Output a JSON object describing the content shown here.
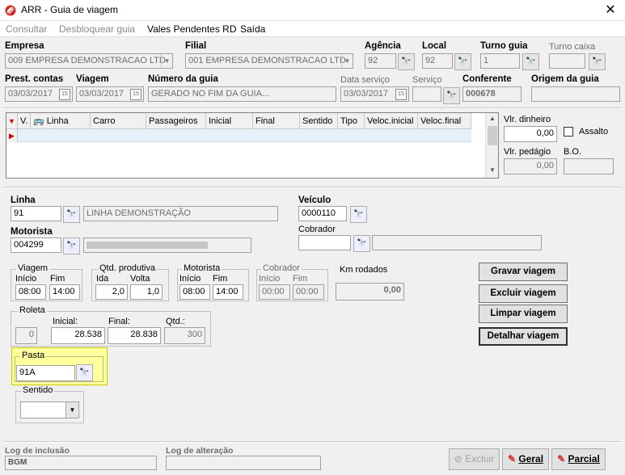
{
  "window": {
    "title": "ARR - Guia de viagem",
    "close": "✕"
  },
  "menu": {
    "consultar": "Consultar",
    "desbloquear": "Desbloquear guia",
    "vales": "Vales Pendentes RD",
    "saida": "Saída"
  },
  "header": {
    "empresa_label": "Empresa",
    "empresa_value": "009 EMPRESA DEMONSTRACAO LTD",
    "filial_label": "Filial",
    "filial_value": "001 EMPRESA DEMONSTRACAO LTD",
    "agencia_label": "Agência",
    "agencia_value": "92",
    "local_label": "Local",
    "local_value": "92",
    "turno_guia_label": "Turno guia",
    "turno_guia_value": "1",
    "turno_caixa_label": "Turno caixa",
    "turno_caixa_value": "",
    "prest_label": "Prest. contas",
    "prest_value": "03/03/2017",
    "viagem_label": "Viagem",
    "viagem_value": "03/03/2017",
    "numero_label": "Número da guia",
    "numero_value": "GERADO NO FIM DA GUIA...",
    "data_servico_label": "Data serviço",
    "data_servico_value": "03/03/2017",
    "servico_label": "Serviço",
    "servico_value": "",
    "conferente_label": "Conferente",
    "conferente_value": "000678",
    "origem_label": "Origem da guia",
    "origem_value": ""
  },
  "grid": {
    "columns": [
      "V.",
      "Linha",
      "Carro",
      "Passageiros",
      "Inicial",
      "Final",
      "Sentido",
      "Tipo",
      "Veloc.inicial",
      "Veloc.final"
    ]
  },
  "side": {
    "dinheiro_label": "Vlr. dinheiro",
    "dinheiro_value": "0,00",
    "assalto_label": "Assalto",
    "pedagio_label": "Vlr. pedágio",
    "pedagio_value": "0,00",
    "bo_label": "B.O.",
    "bo_value": ""
  },
  "detail": {
    "linha_label": "Linha",
    "linha_value": "91",
    "linha_desc": "LINHA DEMONSTRAÇÃO",
    "veiculo_label": "Veículo",
    "veiculo_value": "0000110",
    "motorista_label": "Motorista",
    "motorista_value": "004299",
    "cobrador_label": "Cobrador",
    "cobrador_value": ""
  },
  "viagem_group": {
    "title": "Viagem",
    "inicio_label": "Início",
    "fim_label": "Fim",
    "inicio": "08:00",
    "fim": "14:00"
  },
  "qtd_group": {
    "title": "Qtd. produtiva",
    "ida_label": "Ida",
    "volta_label": "Volta",
    "ida": "2,0",
    "volta": "1,0"
  },
  "mot_group": {
    "title": "Motorista",
    "inicio_label": "Início",
    "fim_label": "Fim",
    "inicio": "08:00",
    "fim": "14:00"
  },
  "cob_group": {
    "title": "Cobrador",
    "inicio_label": "Início",
    "fim_label": "Fim",
    "inicio": "00:00",
    "fim": "00:00"
  },
  "km": {
    "label": "Km rodados",
    "value": "0,00"
  },
  "roleta": {
    "title": "Roleta",
    "num": "0",
    "inicial_label": "Inicial:",
    "inicial": "28.538",
    "final_label": "Final:",
    "final": "28.838",
    "qtd_label": "Qtd.:",
    "qtd": "300"
  },
  "pasta": {
    "title": "Pasta",
    "value": "91A"
  },
  "sentido": {
    "title": "Sentido",
    "value": ""
  },
  "actions": {
    "gravar": "Gravar viagem",
    "excluir": "Excluir viagem",
    "limpar": "Limpar viagem",
    "detalhar": "Detalhar viagem"
  },
  "footer": {
    "log_inc_label": "Log de inclusão",
    "log_inc_value": "BGM",
    "log_alt_label": "Log de alteração",
    "log_alt_value": "",
    "excluir": "Excluir",
    "geral": "Geral",
    "parcial": "Parcial"
  }
}
